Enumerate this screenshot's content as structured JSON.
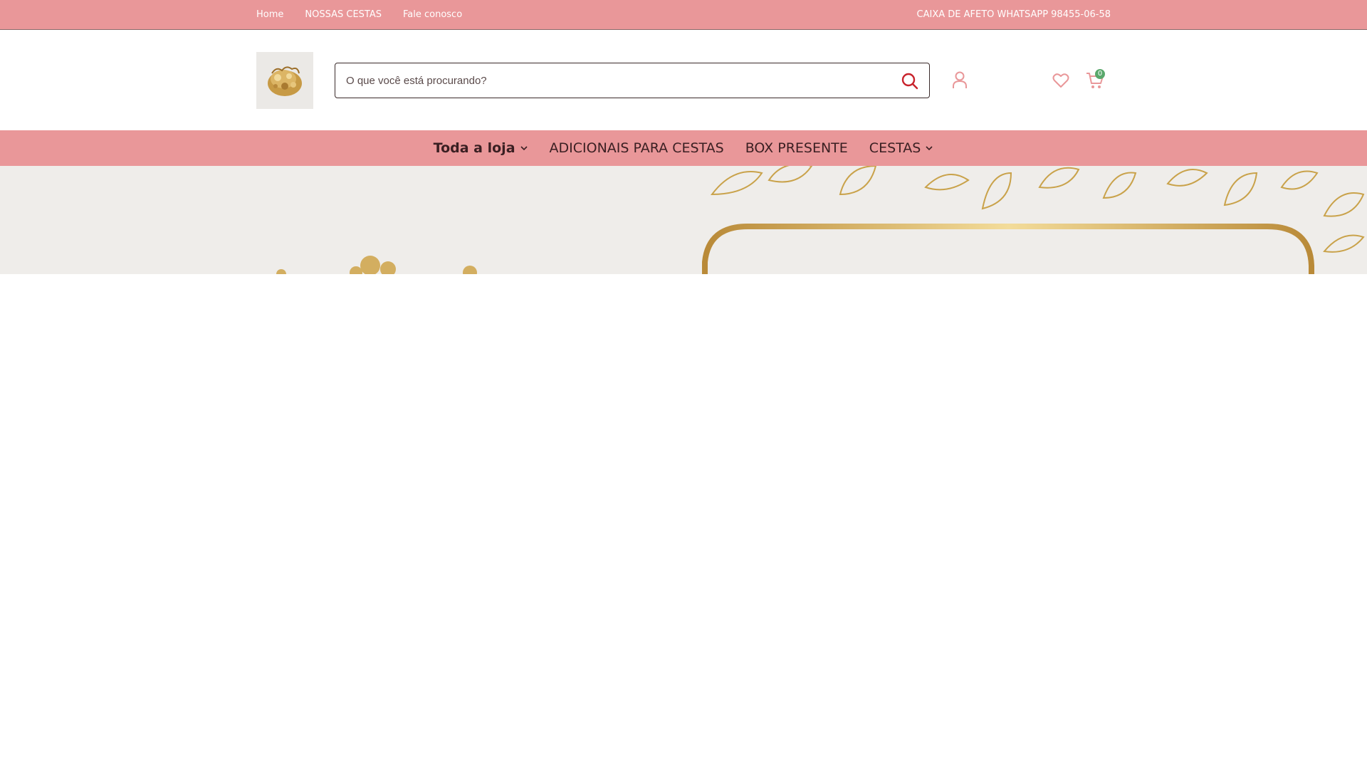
{
  "topbar": {
    "links": [
      "Home",
      "NOSSAS CESTAS",
      "Fale conosco"
    ],
    "promo": "CAIXA DE AFETO WHATSAPP 98455-06-58"
  },
  "search": {
    "placeholder": "O que você está procurando?"
  },
  "cart": {
    "count": "0"
  },
  "nav": {
    "items": [
      {
        "label": "Toda a loja",
        "has_dropdown": true
      },
      {
        "label": "ADICIONAIS PARA CESTAS",
        "has_dropdown": false
      },
      {
        "label": "BOX PRESENTE",
        "has_dropdown": false
      },
      {
        "label": "CESTAS",
        "has_dropdown": true
      }
    ]
  },
  "colors": {
    "topbar_bg": "#e99799",
    "nav_bg": "#e99799",
    "search_icon": "#c8232c",
    "accent_icons": "#e99799",
    "cart_badge": "#5aa86c",
    "gold": "#c9a24a"
  },
  "icons": {
    "search": "search-icon",
    "account": "user-icon",
    "wishlist": "heart-icon",
    "cart": "cart-icon",
    "dropdown": "chevron-down-icon"
  }
}
